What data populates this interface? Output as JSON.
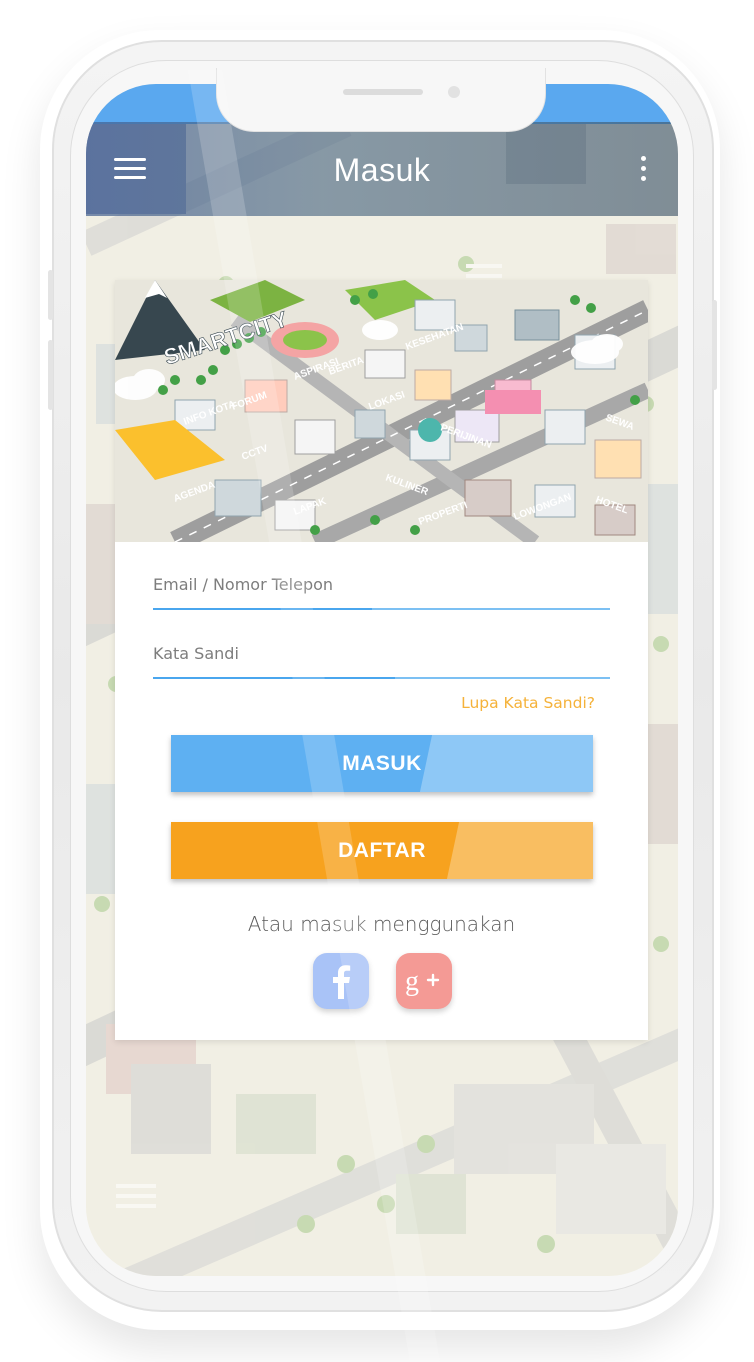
{
  "app_bar": {
    "title": "Masuk",
    "menu_icon": "hamburger-menu-icon",
    "more_icon": "more-vertical-icon",
    "color": "#5aa8ef"
  },
  "banner": {
    "brand_text": "SMARTCITY",
    "labels": [
      "INFO KOTA",
      "FORUM",
      "ASPIRASI",
      "BERITA",
      "KESEHATAN",
      "LOKASI",
      "CCTV",
      "AGENDA",
      "LAPAK",
      "KULINER",
      "PROPERTI",
      "PERIJINAN",
      "HOTEL",
      "SEWA",
      "LOWONGAN"
    ]
  },
  "login_form": {
    "email_placeholder": "Email / Nomor Telepon",
    "password_placeholder": "Kata Sandi",
    "forgot_password": "Lupa Kata Sandi?",
    "login_button": "MASUK",
    "register_button": "DAFTAR",
    "alt_login_text": "Atau masuk menggunakan"
  },
  "social": {
    "facebook_icon": "facebook-icon",
    "google_plus_icon": "google-plus-icon",
    "facebook_color": "#a9c3f7",
    "google_color": "#f49a95"
  },
  "colors": {
    "primary": "#5eb0f2",
    "accent": "#f7a21e",
    "link": "#f5b23a"
  }
}
